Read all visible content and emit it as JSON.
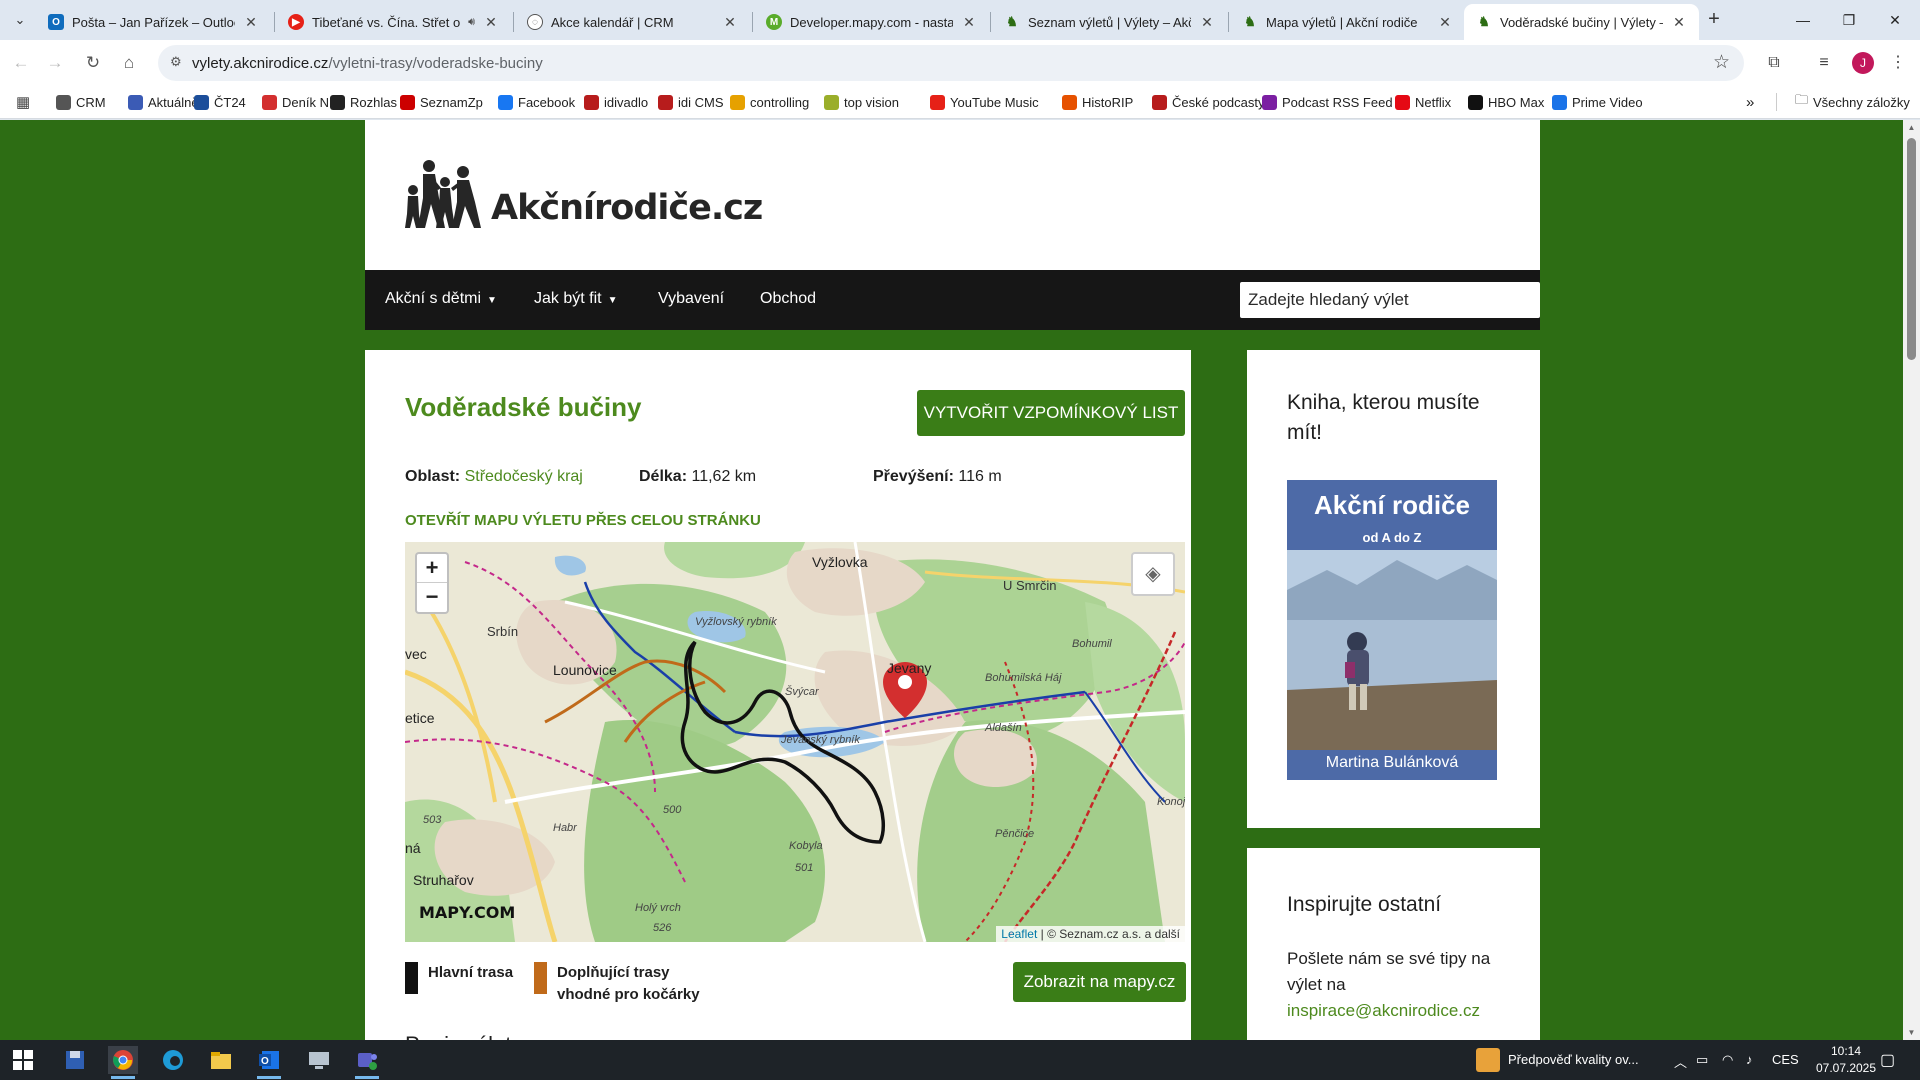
{
  "tabs": [
    {
      "title": "Pošta – Jan Pařízek – Outlook",
      "icon": "outlook-icon",
      "color": "#0f6cbd"
    },
    {
      "title": "Tibeťané vs. Čína. Střet o v",
      "icon": "youtube-icon",
      "color": "#e62117"
    },
    {
      "title": "Akce kalendář | CRM",
      "icon": "globe-icon",
      "color": "#555555"
    },
    {
      "title": "Developer.mapy.com - nastave",
      "icon": "mapy-icon",
      "color": "#5aac2b"
    },
    {
      "title": "Seznam výletů | Výlety – Akční",
      "icon": "akcnirodice-icon",
      "color": "#2d6d14"
    },
    {
      "title": "Mapa výletů | Akční rodiče",
      "icon": "akcnirodice-icon",
      "color": "#2d6d14"
    },
    {
      "title": "Voděradské bučiny | Výlety – Ak",
      "icon": "akcnirodice-icon",
      "color": "#2d6d14"
    }
  ],
  "address": {
    "host": "vylety.akcnirodice.cz",
    "path": "/vyletni-trasy/voderadske-buciny"
  },
  "avatar_letter": "J",
  "bookmarks": [
    {
      "label": "CRM",
      "color": "#555555"
    },
    {
      "label": "Aktuálně",
      "color": "#3b5bb5"
    },
    {
      "label": "ČT24",
      "color": "#1c4e9a"
    },
    {
      "label": "Deník N",
      "color": "#d32f2f"
    },
    {
      "label": "Rozhlas",
      "color": "#222222"
    },
    {
      "label": "SeznamZp",
      "color": "#cc0000"
    },
    {
      "label": "Facebook",
      "color": "#1877f2"
    },
    {
      "label": "idivadlo",
      "color": "#b71c1c"
    },
    {
      "label": "idi CMS",
      "color": "#b71c1c"
    },
    {
      "label": "controlling",
      "color": "#e6a100"
    },
    {
      "label": "top vision",
      "color": "#9aae2a"
    },
    {
      "label": "YouTube Music",
      "color": "#e62117"
    },
    {
      "label": "HistoRIP",
      "color": "#e65100"
    },
    {
      "label": "České podcasty",
      "color": "#b71c1c"
    },
    {
      "label": "Podcast RSS Feed",
      "color": "#7b1fa2"
    },
    {
      "label": "Netflix",
      "color": "#e50914"
    },
    {
      "label": "HBO Max",
      "color": "#111111"
    },
    {
      "label": "Prime Video",
      "color": "#1a73e8"
    }
  ],
  "bookmarks_all": "Všechny záložky",
  "site": {
    "logo_text": "Akčnírodiče.cz",
    "nav": [
      "Akční s dětmi",
      "Jak být fit",
      "Vybavení",
      "Obchod"
    ],
    "search_placeholder": "Zadejte hledaný výlet"
  },
  "trip": {
    "title": "Voděradské bučiny",
    "memory_button": "VYTVOŘIT VZPOMÍNKOVÝ LIST",
    "region_label": "Oblast:",
    "region_value": "Středočeský kraj",
    "length_label": "Délka:",
    "length_value": "11,62 km",
    "elevation_label": "Převýšení:",
    "elevation_value": "116 m",
    "open_map": "OTEVŘÍT MAPU VÝLETU PŘES CELOU STRÁNKU",
    "legend_main": "Hlavní trasa",
    "legend_main_color": "#111111",
    "legend_secondary": "Doplňující trasy vhodné pro kočárky",
    "legend_secondary_color": "#c06a1a",
    "mapy_button": "Zobrazit na mapy.cz",
    "description_heading": "Popis výletu"
  },
  "map": {
    "zoom_in": "+",
    "zoom_out": "−",
    "logo": "MAPY.COM",
    "attribution_leaflet": "Leaflet",
    "attribution_rest": "| © Seznam.cz a.s. a další",
    "labels": [
      "Vyžlovka",
      "U Smrčin",
      "Srbín",
      "Lounovice",
      "Jevany",
      "Bohumil",
      "Bohumilská Háj",
      "Aldašín",
      "Struhařov",
      "Kobyla",
      "501",
      "500",
      "503",
      "Holý vrch",
      "526",
      "Pěnčice",
      "Konoj Háj",
      "Habr",
      "vec",
      "etice",
      "ná",
      "Vyžlovský rybník",
      "Jevanský rybník",
      "Švýcar"
    ]
  },
  "sidebar": {
    "book_heading": "Kniha, kterou musíte mít!",
    "book_title": "Akční rodiče",
    "book_subtitle": "od A do Z",
    "book_author": "Martina Bulánková",
    "inspire_heading": "Inspirujte ostatní",
    "inspire_text": "Pošlete nám se své tipy na výlet na",
    "inspire_email": "inspirace@akcnirodice.cz"
  },
  "taskbar": {
    "weather": "Předpověď kvality ov...",
    "lang": "CES",
    "time": "10:14",
    "date": "07.07.2025"
  }
}
